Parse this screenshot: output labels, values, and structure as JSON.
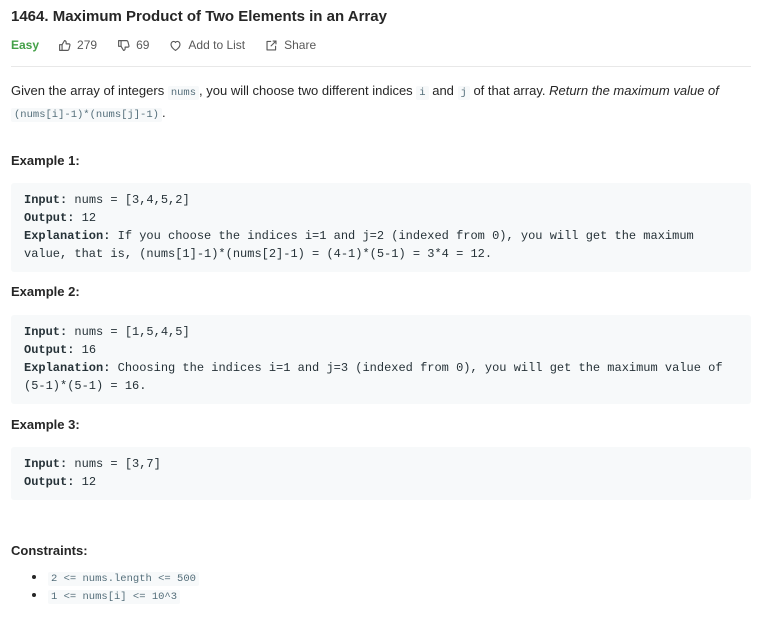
{
  "problem": {
    "title": "1464. Maximum Product of Two Elements in an Array",
    "difficulty": "Easy",
    "likes": "279",
    "dislikes": "69",
    "add_to_list": "Add to List",
    "share": "Share"
  },
  "description": {
    "p1": "Given the array of integers ",
    "code_nums": "nums",
    "p2": ", you will choose two different indices ",
    "code_i": "i",
    "p3": " and ",
    "code_j": "j",
    "p4": " of that array. ",
    "italic": "Return the maximum value of",
    "code_expr": "(nums[i]-1)*(nums[j]-1)",
    "p5": "."
  },
  "examples": [
    {
      "title": "Example 1:",
      "input_label": "Input:",
      "input_value": " nums = [3,4,5,2]",
      "output_label": "Output:",
      "output_value": " 12",
      "explanation_label": "Explanation:",
      "explanation_value": " If you choose the indices i=1 and j=2 (indexed from 0), you will get the maximum value, that is, (nums[1]-1)*(nums[2]-1) = (4-1)*(5-1) = 3*4 = 12."
    },
    {
      "title": "Example 2:",
      "input_label": "Input:",
      "input_value": " nums = [1,5,4,5]",
      "output_label": "Output:",
      "output_value": " 16",
      "explanation_label": "Explanation:",
      "explanation_value": " Choosing the indices i=1 and j=3 (indexed from 0), you will get the maximum value of (5-1)*(5-1) = 16."
    },
    {
      "title": "Example 3:",
      "input_label": "Input:",
      "input_value": " nums = [3,7]",
      "output_label": "Output:",
      "output_value": " 12"
    }
  ],
  "constraints": {
    "title": "Constraints:",
    "items": [
      "2 <= nums.length <= 500",
      "1 <= nums[i] <= 10^3"
    ]
  },
  "colors": {
    "difficulty_easy": "#43a047",
    "code_background": "#f7f9fa"
  }
}
